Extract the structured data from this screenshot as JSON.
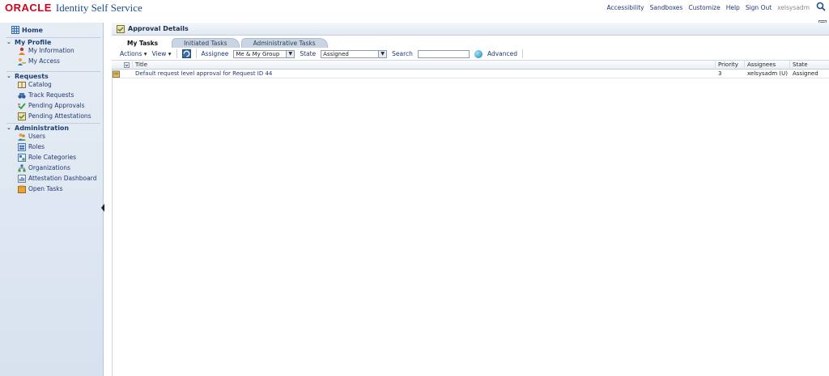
{
  "brand": {
    "logo": "ORACLE",
    "app_title": "Identity Self Service"
  },
  "global_links": [
    "Accessibility",
    "Sandboxes",
    "Customize",
    "Help",
    "Sign Out"
  ],
  "user": "xelsysadm",
  "sidebar": {
    "home": "Home",
    "sections": [
      {
        "title": "My Profile",
        "items": [
          {
            "label": "My Information",
            "icon": "user-info-icon"
          },
          {
            "label": "My Access",
            "icon": "key-user-icon"
          }
        ]
      },
      {
        "title": "Requests",
        "items": [
          {
            "label": "Catalog",
            "icon": "catalog-icon"
          },
          {
            "label": "Track Requests",
            "icon": "binoculars-icon"
          },
          {
            "label": "Pending Approvals",
            "icon": "check-arrow-icon"
          },
          {
            "label": "Pending Attestations",
            "icon": "attestation-icon"
          }
        ]
      },
      {
        "title": "Administration",
        "items": [
          {
            "label": "Users",
            "icon": "users-icon"
          },
          {
            "label": "Roles",
            "icon": "roles-icon"
          },
          {
            "label": "Role Categories",
            "icon": "role-categories-icon"
          },
          {
            "label": "Organizations",
            "icon": "organizations-icon"
          },
          {
            "label": "Attestation Dashboard",
            "icon": "dashboard-icon"
          },
          {
            "label": "Open Tasks",
            "icon": "open-tasks-icon"
          }
        ]
      }
    ]
  },
  "main": {
    "region_title": "Approval Details",
    "tabs": [
      "My Tasks",
      "Initiated Tasks",
      "Administrative Tasks"
    ],
    "toolbar": {
      "actions": "Actions",
      "view": "View",
      "assignee_label": "Assignee",
      "assignee_value": "Me & My Group",
      "state_label": "State",
      "state_value": "Assigned",
      "search_label": "Search",
      "advanced": "Advanced"
    },
    "table": {
      "columns": {
        "title": "Title",
        "priority": "Priority",
        "assignees": "Assignees",
        "state": "State"
      },
      "rows": [
        {
          "title": "Default request level approval for Request ID 44",
          "priority": "3",
          "assignees": "xelsysadm (U)",
          "state": "Assigned"
        }
      ]
    }
  },
  "colors": {
    "brand_red": "#d0021b",
    "link_blue": "#1f3a73",
    "sidebar_bg": "#dde6f1"
  }
}
